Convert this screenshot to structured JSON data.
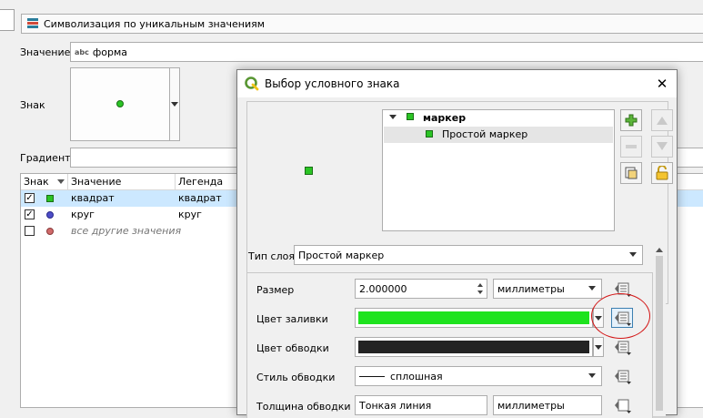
{
  "renderer": {
    "label": "Символизация по уникальным значениям"
  },
  "value_row": {
    "label": "Значение",
    "value": "форма",
    "type_badge": "abc"
  },
  "symbol_row": {
    "label": "Знак"
  },
  "gradient_row": {
    "label": "Градиент"
  },
  "categories": {
    "headers": {
      "symbol": "Знак",
      "value": "Значение",
      "legend": "Легенда"
    },
    "rows": [
      {
        "value": "квадрат",
        "legend": "квадрат",
        "checked": "✓",
        "symbol_color": "#2bc425"
      },
      {
        "value": "круг",
        "legend": "круг",
        "checked": "✓",
        "symbol_color": "#4d4dc8"
      },
      {
        "value": "все другие значения",
        "legend": "",
        "checked": "",
        "symbol_color": "#d06a6a"
      }
    ]
  },
  "dialog": {
    "title": "Выбор условного знака",
    "tree": {
      "root": "маркер",
      "child": "Простой маркер"
    },
    "layer_type": {
      "label": "Тип слоя",
      "value": "Простой маркер"
    },
    "size": {
      "label": "Размер",
      "value": "2.000000",
      "unit": "миллиметры"
    },
    "fill_color": {
      "label": "Цвет заливки",
      "color": "#1ee31e"
    },
    "stroke_color": {
      "label": "Цвет обводки",
      "color": "#232323"
    },
    "stroke_style": {
      "label": "Стиль обводки",
      "value": "сплошная"
    },
    "stroke_width": {
      "label": "Толщина обводки",
      "value": "Тонкая линия",
      "unit": "миллиметры"
    }
  },
  "colors": {
    "highlight": "#cce8ff",
    "annotation": "#d31616",
    "qgis_green": "#589632"
  }
}
